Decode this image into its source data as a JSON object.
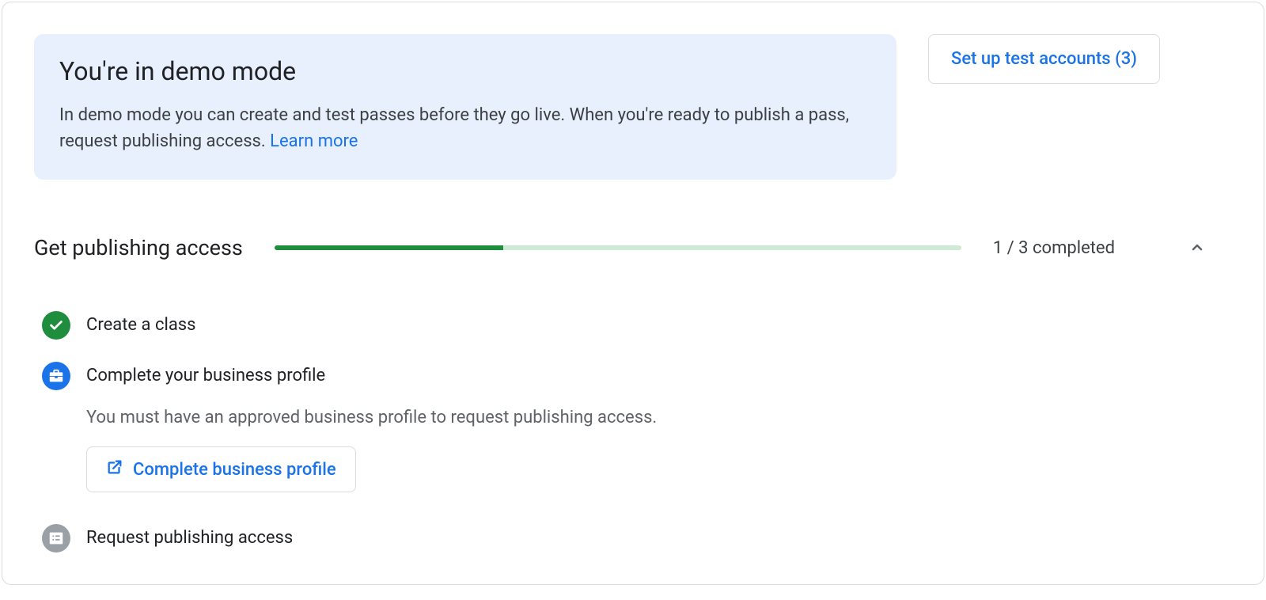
{
  "banner": {
    "title": "You're in demo mode",
    "body": "In demo mode you can create and test passes before they go live. When you're ready to publish a pass, request publishing access. ",
    "learn_more": "Learn more"
  },
  "setup_button": "Set up test accounts (3)",
  "progress": {
    "title": "Get publishing access",
    "count_text": "1 / 3 completed",
    "percent": 33.33
  },
  "steps": {
    "create_class": {
      "title": "Create a class"
    },
    "business_profile": {
      "title": "Complete your business profile",
      "desc": "You must have an approved business profile to request publishing access.",
      "action": "Complete business profile"
    },
    "request_access": {
      "title": "Request publishing access"
    }
  }
}
